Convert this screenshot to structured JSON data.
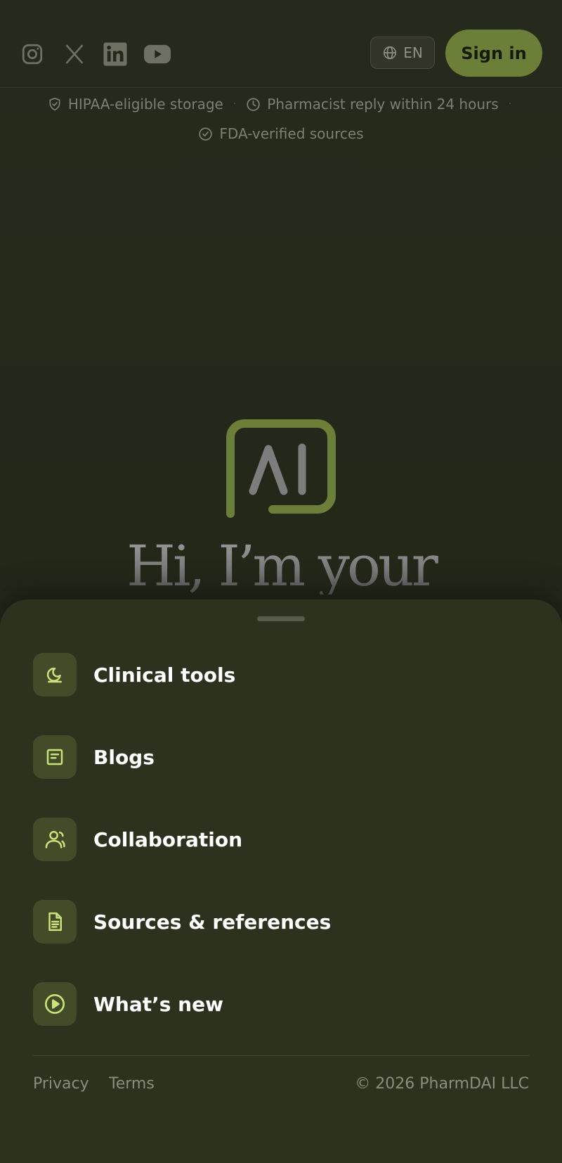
{
  "header": {
    "social": [
      {
        "icon": "instagram-icon",
        "label": "Instagram"
      },
      {
        "icon": "x-icon",
        "label": "X"
      },
      {
        "icon": "linkedin-icon",
        "label": "LinkedIn"
      },
      {
        "icon": "youtube-icon",
        "label": "YouTube"
      }
    ],
    "language": "EN",
    "signin_label": "Sign in"
  },
  "trust": {
    "items": [
      "HIPAA-eligible storage",
      "Pharmacist reply within 24 hours",
      "FDA-verified sources"
    ],
    "icons": [
      "shield-check-icon",
      "clock-icon",
      "check-circle-icon"
    ]
  },
  "hero": {
    "logo_text": "AI",
    "title": "Hi, I’m your"
  },
  "menu": {
    "items": [
      {
        "label": "Clinical tools",
        "icon": "tool-icon"
      },
      {
        "label": "Blogs",
        "icon": "blog-icon"
      },
      {
        "label": "Collaboration",
        "icon": "user-icon"
      },
      {
        "label": "Sources & references",
        "icon": "document-icon"
      },
      {
        "label": "What’s new",
        "icon": "play-circle-icon"
      }
    ]
  },
  "footer": {
    "privacy": "Privacy",
    "terms": "Terms",
    "copyright": "© 2026 PharmDAI LLC"
  },
  "colors": {
    "accent": "#6c7f39",
    "icon_lime": "#c9e27a",
    "sheet_bg": "#2d321e",
    "page_bg": "#23271a"
  }
}
